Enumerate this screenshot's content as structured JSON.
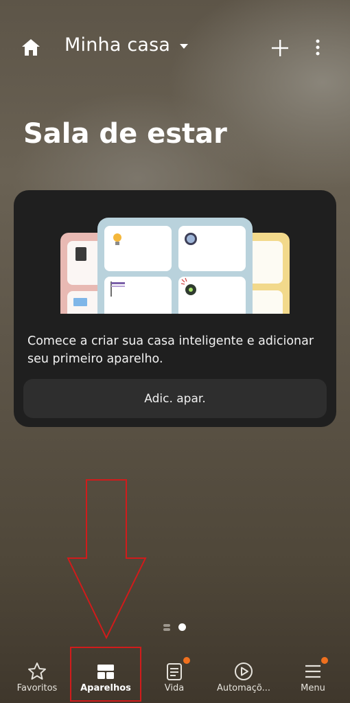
{
  "header": {
    "home_title": "Minha casa",
    "room_title": "Sala de estar",
    "icons": [
      "home-icon",
      "chevron-down-icon",
      "plus-icon",
      "more-vert-icon"
    ]
  },
  "card": {
    "message": "Comece a criar sua casa inteligente e adicionar seu primeiro aparelho.",
    "button_label": "Adic. apar."
  },
  "pager": {
    "pages": 2,
    "current": 2
  },
  "nav": {
    "items": [
      {
        "label": "Favoritos",
        "icon": "star-icon",
        "badge": false,
        "active": false
      },
      {
        "label": "Aparelhos",
        "icon": "devices-grid-icon",
        "badge": false,
        "active": true
      },
      {
        "label": "Vida",
        "icon": "life-icon",
        "badge": true,
        "active": false
      },
      {
        "label": "Automaçõ...",
        "icon": "play-circle-icon",
        "badge": false,
        "active": false
      },
      {
        "label": "Menu",
        "icon": "menu-icon",
        "badge": true,
        "active": false
      }
    ]
  },
  "colors": {
    "badge": "#f0701e",
    "annotation": "#d11b1b",
    "card": "#1f1f1f"
  }
}
